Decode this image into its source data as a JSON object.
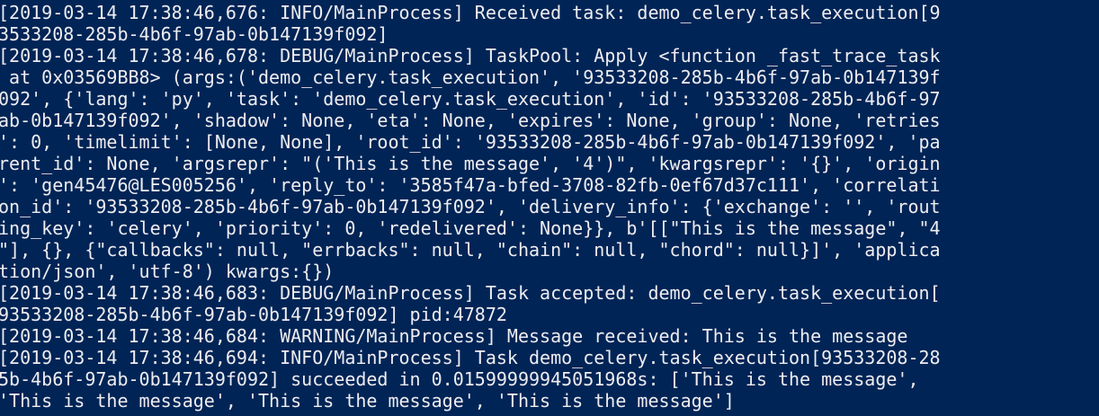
{
  "terminal": {
    "background": "#012456",
    "foreground": "#eeedf0",
    "lines": [
      "[2019-03-14 17:38:46,676: INFO/MainProcess] Received task: demo_celery.task_execution[9",
      "3533208-285b-4b6f-97ab-0b147139f092]",
      "[2019-03-14 17:38:46,678: DEBUG/MainProcess] TaskPool: Apply <function _fast_trace_task",
      " at 0x03569BB8> (args:('demo_celery.task_execution', '93533208-285b-4b6f-97ab-0b147139f",
      "092', {'lang': 'py', 'task': 'demo_celery.task_execution', 'id': '93533208-285b-4b6f-97",
      "ab-0b147139f092', 'shadow': None, 'eta': None, 'expires': None, 'group': None, 'retries",
      "': 0, 'timelimit': [None, None], 'root_id': '93533208-285b-4b6f-97ab-0b147139f092', 'pa",
      "rent_id': None, 'argsrepr': \"('This is the message', '4')\", 'kwargsrepr': '{}', 'origin",
      "': 'gen45476@LES005256', 'reply_to': '3585f47a-bfed-3708-82fb-0ef67d37c111', 'correlati",
      "on_id': '93533208-285b-4b6f-97ab-0b147139f092', 'delivery_info': {'exchange': '', 'rout",
      "ing_key': 'celery', 'priority': 0, 'redelivered': None}}, b'[[\"This is the message\", \"4",
      "\"], {}, {\"callbacks\": null, \"errbacks\": null, \"chain\": null, \"chord\": null}]', 'applica",
      "tion/json', 'utf-8') kwargs:{})",
      "[2019-03-14 17:38:46,683: DEBUG/MainProcess] Task accepted: demo_celery.task_execution[",
      "93533208-285b-4b6f-97ab-0b147139f092] pid:47872",
      "[2019-03-14 17:38:46,684: WARNING/MainProcess] Message received: This is the message",
      "[2019-03-14 17:38:46,694: INFO/MainProcess] Task demo_celery.task_execution[93533208-28",
      "5b-4b6f-97ab-0b147139f092] succeeded in 0.01599999945051968s: ['This is the message',",
      "'This is the message', 'This is the message', 'This is the message']"
    ]
  }
}
